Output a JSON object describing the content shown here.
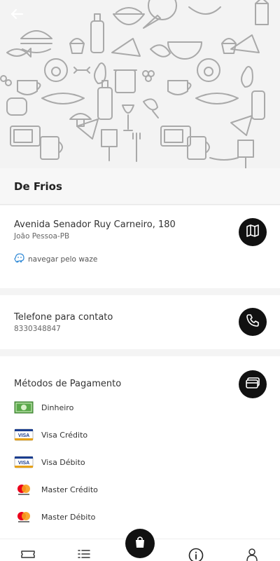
{
  "store": {
    "name": "De Frios"
  },
  "address": {
    "street": "Avenida Senador Ruy Carneiro, 180",
    "city": "João Pessoa-PB",
    "waze_label": "navegar pelo waze"
  },
  "phone": {
    "label": "Telefone para contato",
    "number": "8330348847"
  },
  "payment": {
    "title": "Métodos de Pagamento",
    "methods": [
      {
        "label": "Dinheiro",
        "icon": "cash-icon"
      },
      {
        "label": "Visa Crédito",
        "icon": "visa-card-icon"
      },
      {
        "label": "Visa Débito",
        "icon": "visa-card-icon"
      },
      {
        "label": "Master Crédito",
        "icon": "mastercard-icon"
      },
      {
        "label": "Master Débito",
        "icon": "mastercard-icon"
      }
    ]
  },
  "nav": {
    "items": [
      "ticket-icon",
      "list-icon",
      "bag-icon",
      "info-icon",
      "user-icon"
    ],
    "active": "bag-icon"
  },
  "colors": {
    "accent": "#111111",
    "background": "#f4f4f4",
    "card": "#ffffff"
  }
}
